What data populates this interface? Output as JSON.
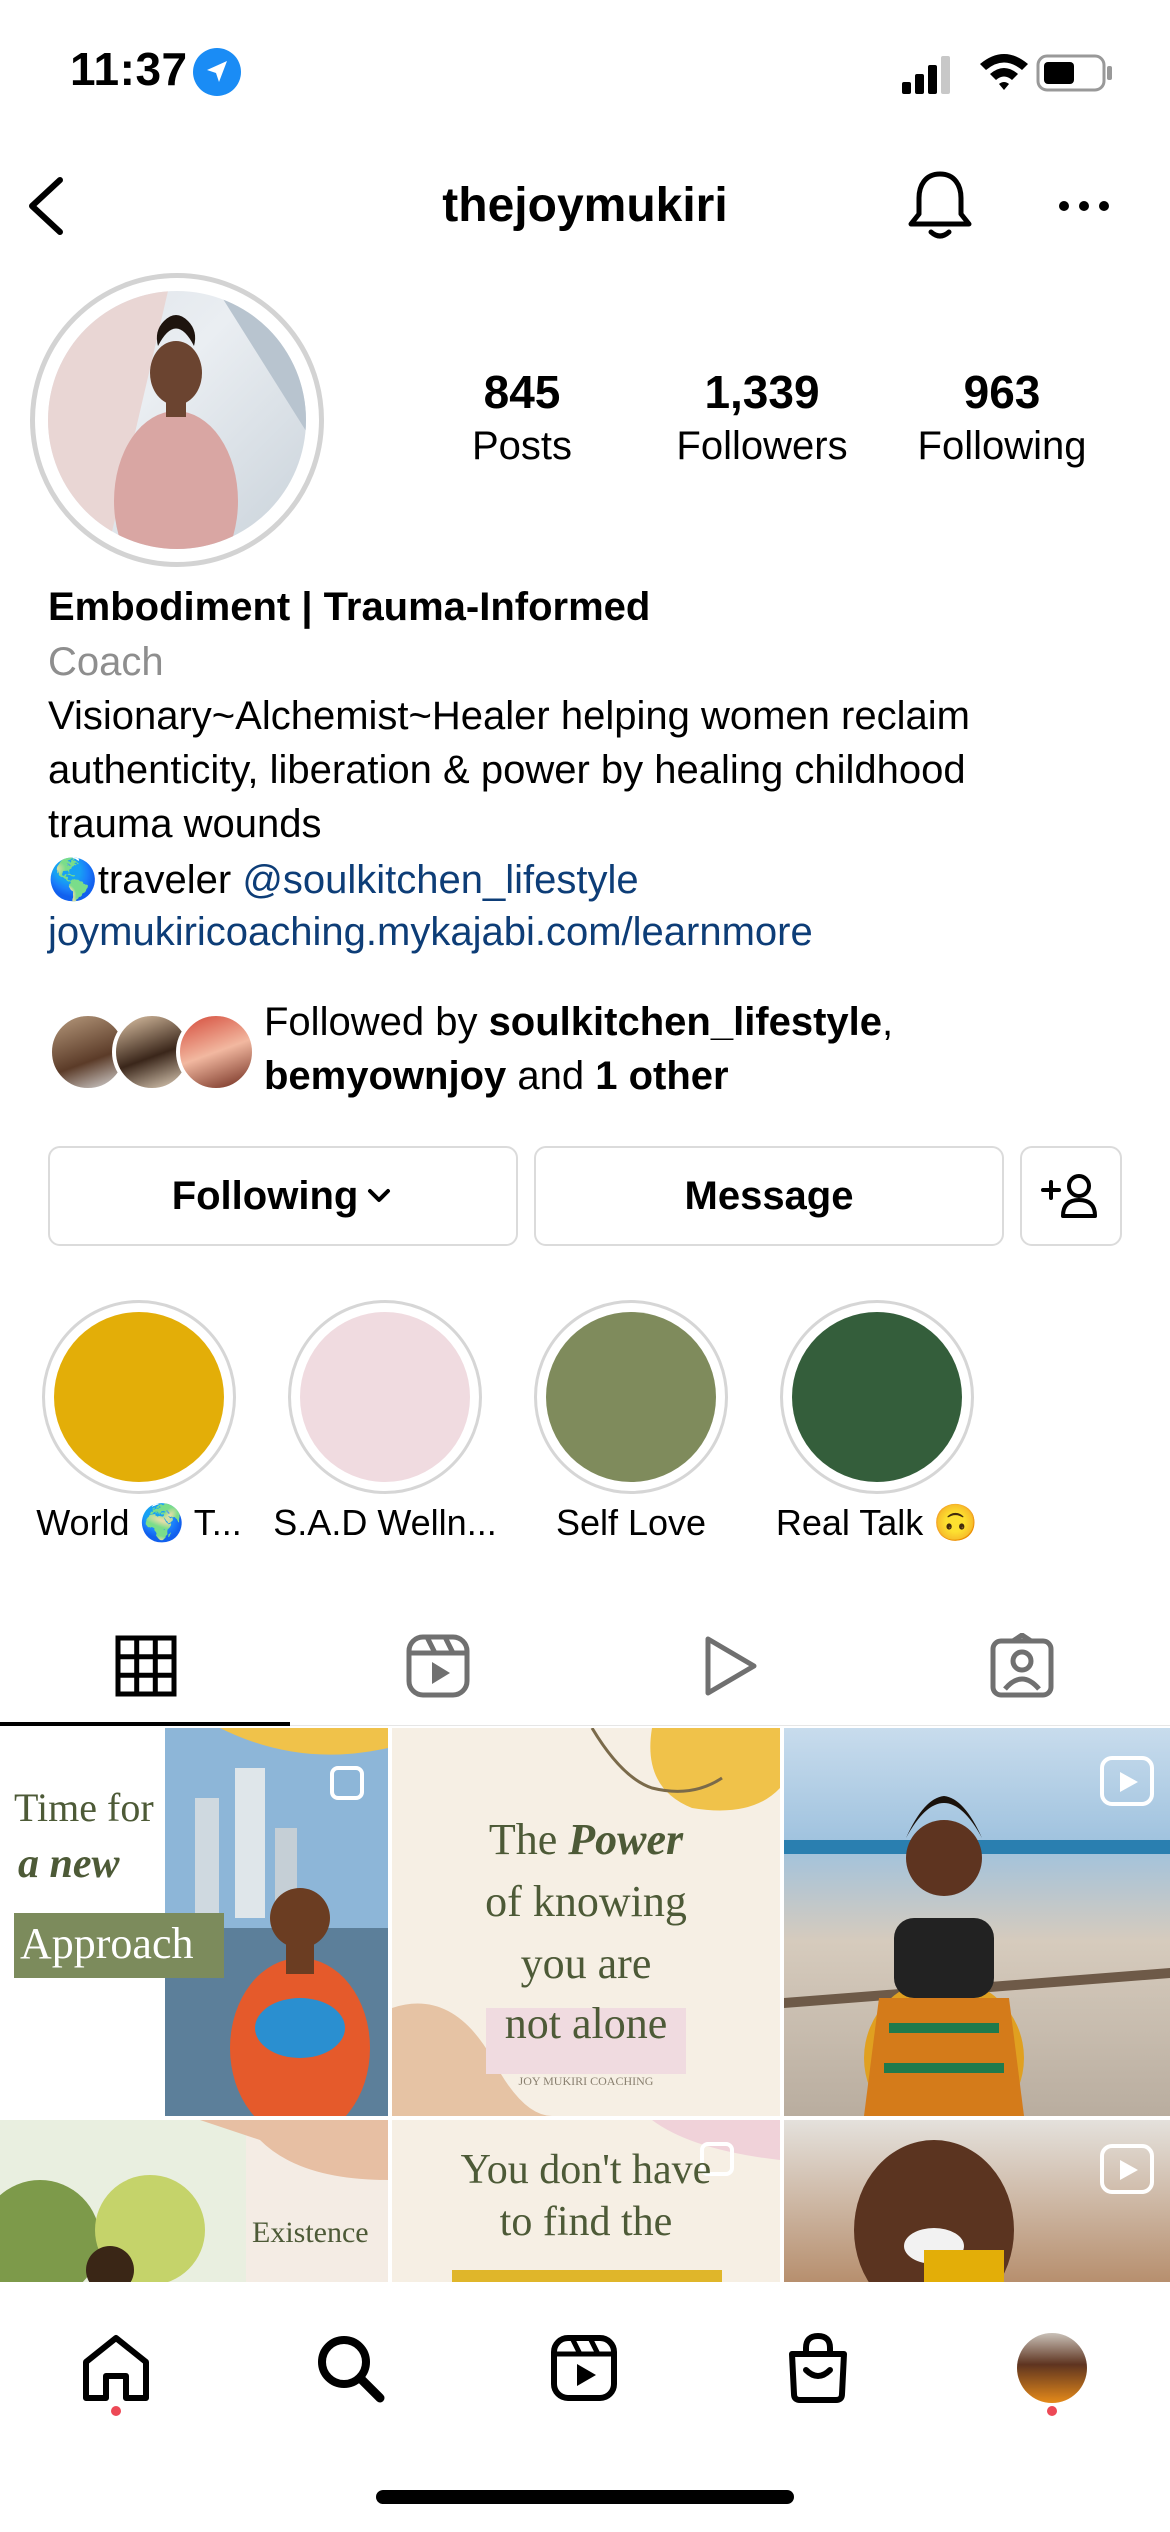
{
  "status_bar": {
    "time": "11:37",
    "location_icon": "location-arrow-icon",
    "signal_icon": "cellular-signal-icon",
    "wifi_icon": "wifi-icon",
    "battery_icon": "battery-icon"
  },
  "header": {
    "username": "thejoymukiri",
    "back_icon": "chevron-left-icon",
    "bell_icon": "bell-icon",
    "more_icon": "more-dots-icon"
  },
  "stats": [
    {
      "value": "845",
      "label": "Posts"
    },
    {
      "value": "1,339",
      "label": "Followers"
    },
    {
      "value": "963",
      "label": "Following"
    }
  ],
  "bio": {
    "name": "Embodiment | Trauma-Informed",
    "category": "Coach",
    "line1": "Visionary~Alchemist~Healer helping women reclaim",
    "line2": "authenticity, liberation & power by healing childhood",
    "line3": "trauma wounds",
    "line4_emoji": "🌎",
    "line4_text": "traveler ",
    "line4_mention": "@soulkitchen_lifestyle",
    "link": "joymukiricoaching.mykajabi.com/learnmore"
  },
  "followed_by": {
    "prefix": "Followed by ",
    "user1": "soulkitchen_lifestyle",
    "comma": ",",
    "user2": "bemyownjoy",
    "and": " and ",
    "others": "1 other"
  },
  "buttons": {
    "following": "Following",
    "message": "Message"
  },
  "highlights": [
    {
      "label": "World 🌍 T...",
      "color": "#e3ae08"
    },
    {
      "label": "S.A.D Welln...",
      "color": "#f0dbe0"
    },
    {
      "label": "Self Love",
      "color": "#7f8b5c"
    },
    {
      "label": "Real Talk 🙃",
      "color": "#345e3b"
    }
  ],
  "tabs": [
    "grid-icon",
    "reels-icon",
    "play-icon",
    "tagged-icon"
  ],
  "posts": {
    "p1": {
      "line1": "Time for",
      "line2": "a new",
      "line3": "Approach"
    },
    "p2": {
      "line1": "The ",
      "line1b": "Power",
      "line2": "of knowing",
      "line3": "you are",
      "line4": "not alone",
      "footer": "JOY MUKIRI COACHING"
    },
    "p4": {
      "word": "Existence"
    },
    "p5": {
      "line1": "You don't have",
      "line2": "to find the"
    }
  },
  "nav": [
    "home-icon",
    "search-icon",
    "reels-icon",
    "shop-icon",
    "profile-avatar"
  ],
  "colors": {
    "link_blue": "#0d3d77",
    "secondary_text": "#8e8e8e",
    "border": "#dbdbdb",
    "notification_red": "#ed4956"
  }
}
